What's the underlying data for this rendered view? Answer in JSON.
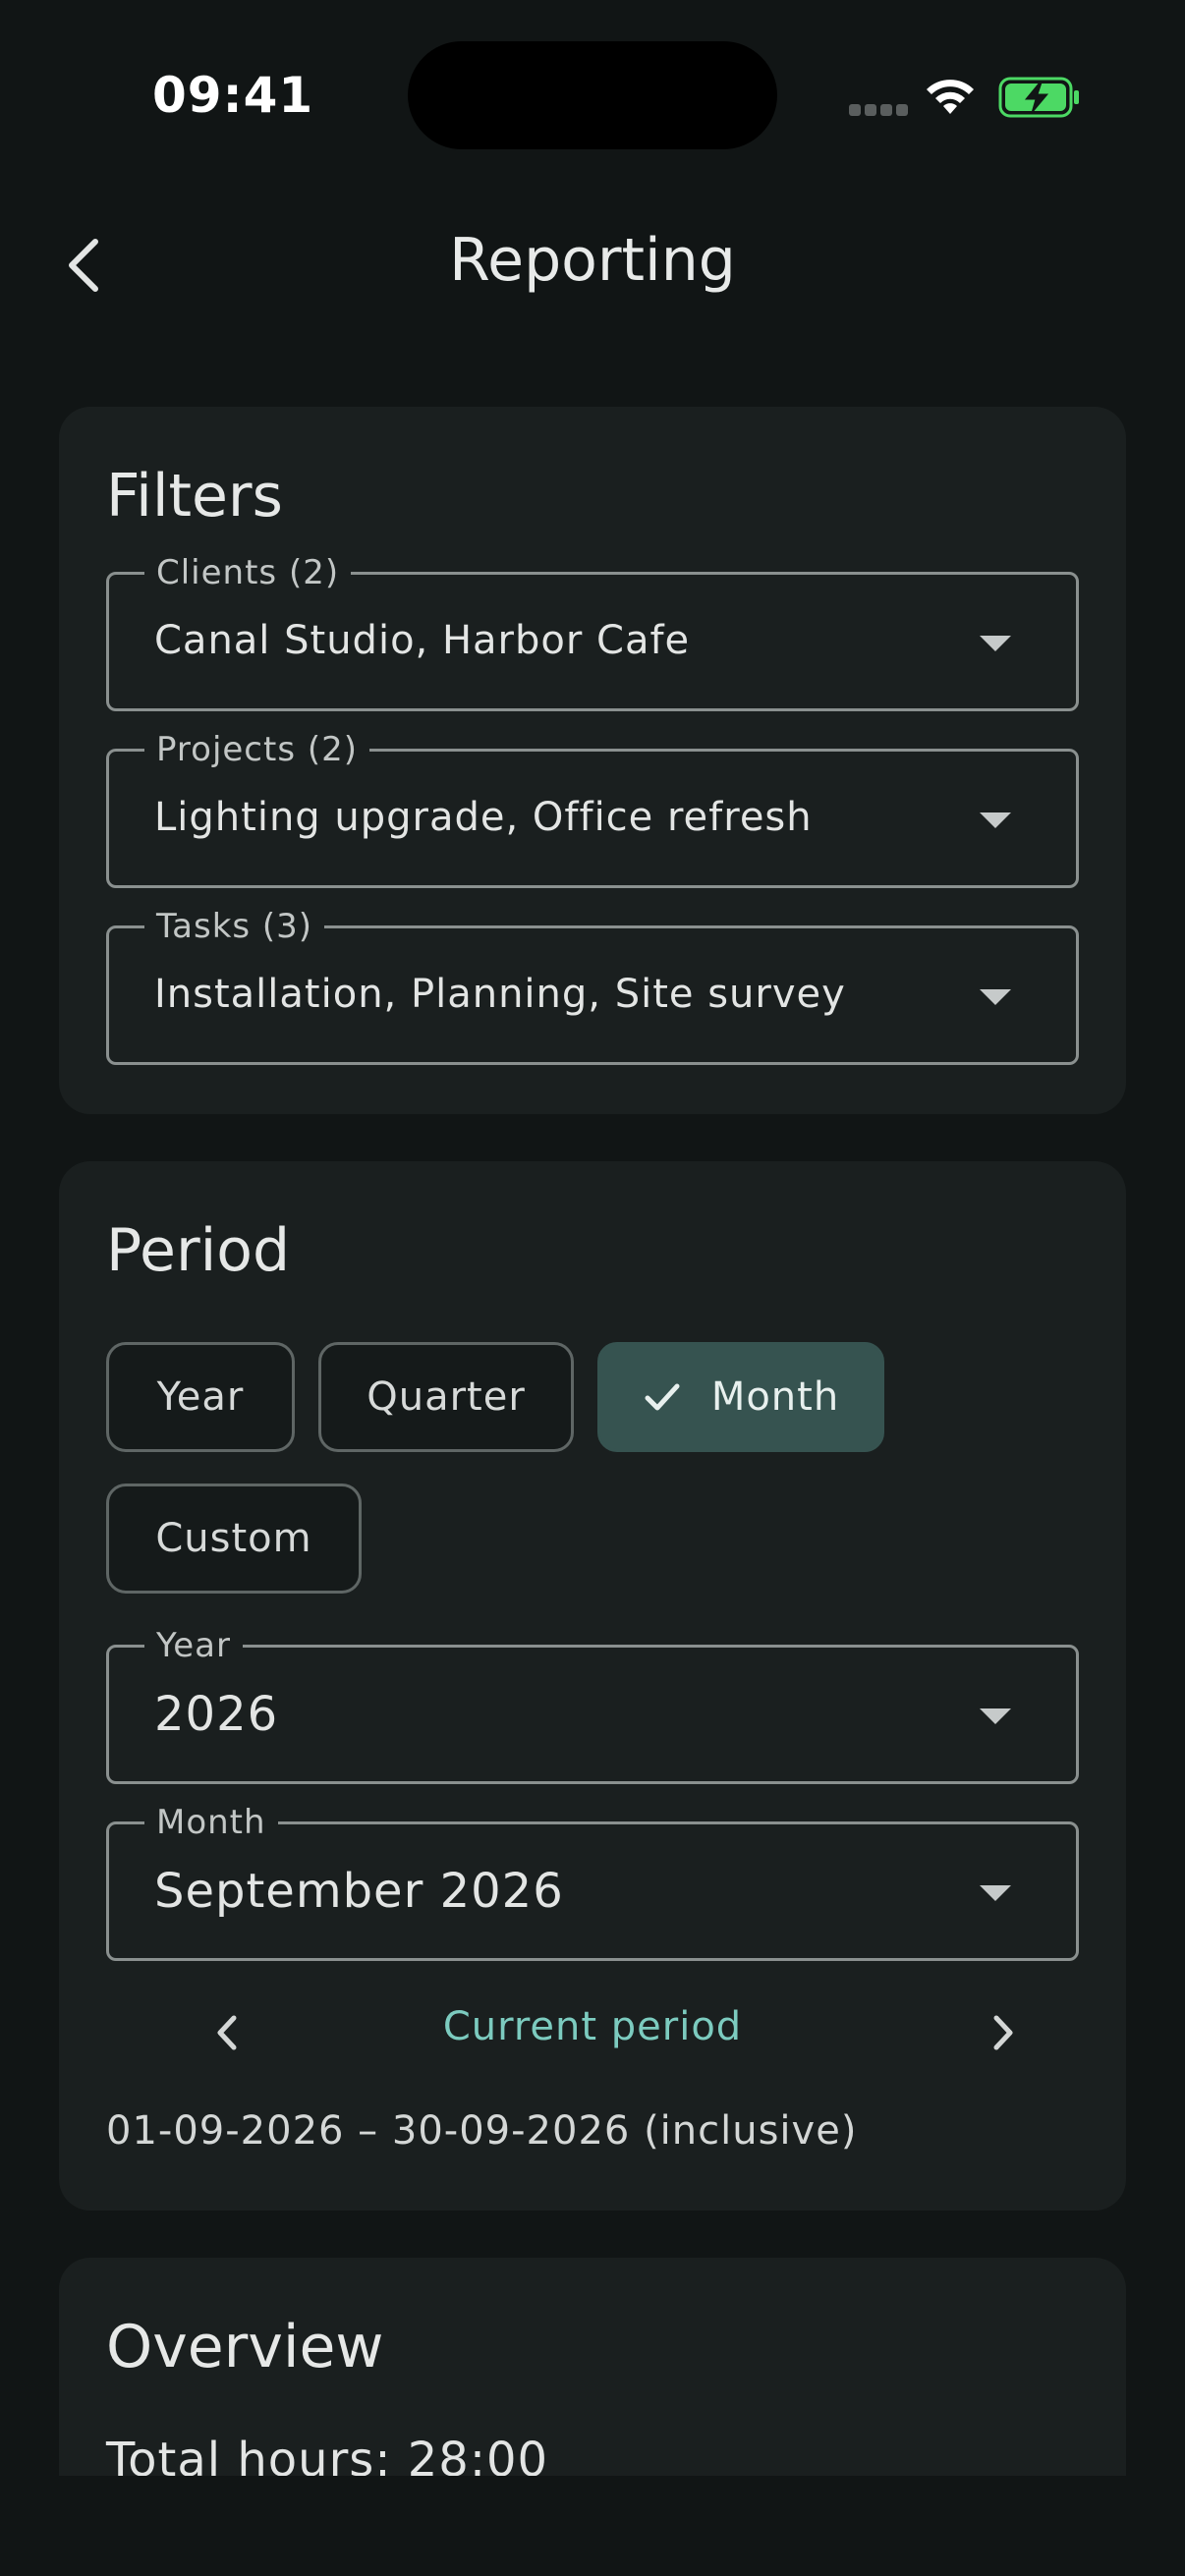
{
  "status_bar": {
    "time": "09:41"
  },
  "app_bar": {
    "title": "Reporting"
  },
  "filters": {
    "title": "Filters",
    "clients": {
      "label": "Clients (2)",
      "value": "Canal Studio, Harbor Cafe"
    },
    "projects": {
      "label": "Projects (2)",
      "value": "Lighting upgrade, Office refresh"
    },
    "tasks": {
      "label": "Tasks (3)",
      "value": "Installation, Planning, Site survey"
    }
  },
  "period": {
    "title": "Period",
    "chips": [
      {
        "label": "Year",
        "selected": false
      },
      {
        "label": "Quarter",
        "selected": false
      },
      {
        "label": "Month",
        "selected": true
      },
      {
        "label": "Custom",
        "selected": false
      }
    ],
    "year": {
      "label": "Year",
      "value": "2026"
    },
    "month": {
      "label": "Month",
      "value": "September 2026"
    },
    "current_period_label": "Current period",
    "range_text": "01-09-2026 – 30-09-2026 (inclusive)"
  },
  "overview": {
    "title": "Overview",
    "total_hours": "Total hours: 28:00"
  },
  "colors": {
    "background": "#111515",
    "card": "#1a1f1f",
    "accent": "#7ccbbf",
    "chip_selected": "#365350",
    "battery_green": "#4cd964"
  }
}
